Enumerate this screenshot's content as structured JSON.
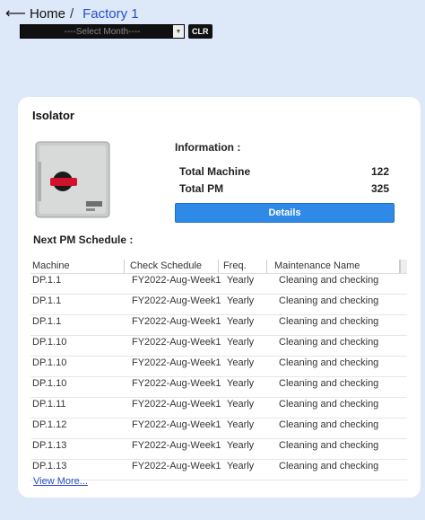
{
  "breadcrumb": {
    "back_icon": "left-arrow-icon",
    "home": "Home",
    "separator": "/",
    "current": "Factory 1"
  },
  "month_filter": {
    "selected": "----Select Month----",
    "clear_label": "CLR"
  },
  "card": {
    "title": "Isolator",
    "image_icon": "isolator-switch-image",
    "info_title": "Information :",
    "total_machine_label": "Total Machine",
    "total_machine_value": "122",
    "total_pm_label": "Total PM",
    "total_pm_value": "325",
    "details_label": "Details",
    "pm_title": "Next PM Schedule :",
    "columns": [
      "Machine",
      "Check Schedule",
      "Freq.",
      "Maintenance Name"
    ],
    "rows": [
      {
        "machine": "DP.1.1",
        "schedule": "FY2022-Aug-Week1",
        "freq": "Yearly",
        "maint": "Cleaning and checking"
      },
      {
        "machine": "DP.1.1",
        "schedule": "FY2022-Aug-Week1",
        "freq": "Yearly",
        "maint": "Cleaning and checking"
      },
      {
        "machine": "DP.1.1",
        "schedule": "FY2022-Aug-Week1",
        "freq": "Yearly",
        "maint": "Cleaning and checking"
      },
      {
        "machine": "DP.1.10",
        "schedule": "FY2022-Aug-Week1",
        "freq": "Yearly",
        "maint": "Cleaning and checking"
      },
      {
        "machine": "DP.1.10",
        "schedule": "FY2022-Aug-Week1",
        "freq": "Yearly",
        "maint": "Cleaning and checking"
      },
      {
        "machine": "DP.1.10",
        "schedule": "FY2022-Aug-Week1",
        "freq": "Yearly",
        "maint": "Cleaning and checking"
      },
      {
        "machine": "DP.1.11",
        "schedule": "FY2022-Aug-Week1",
        "freq": "Yearly",
        "maint": "Cleaning and checking"
      },
      {
        "machine": "DP.1.12",
        "schedule": "FY2022-Aug-Week1",
        "freq": "Yearly",
        "maint": "Cleaning and checking"
      },
      {
        "machine": "DP.1.13",
        "schedule": "FY2022-Aug-Week1",
        "freq": "Yearly",
        "maint": "Cleaning and checking"
      },
      {
        "machine": "DP.1.13",
        "schedule": "FY2022-Aug-Week1",
        "freq": "Yearly",
        "maint": "Cleaning and checking"
      }
    ],
    "view_more": "View More..."
  },
  "colors": {
    "page_bg": "#dde9f8",
    "link": "#2b4fc8",
    "button": "#2e8ae6"
  }
}
